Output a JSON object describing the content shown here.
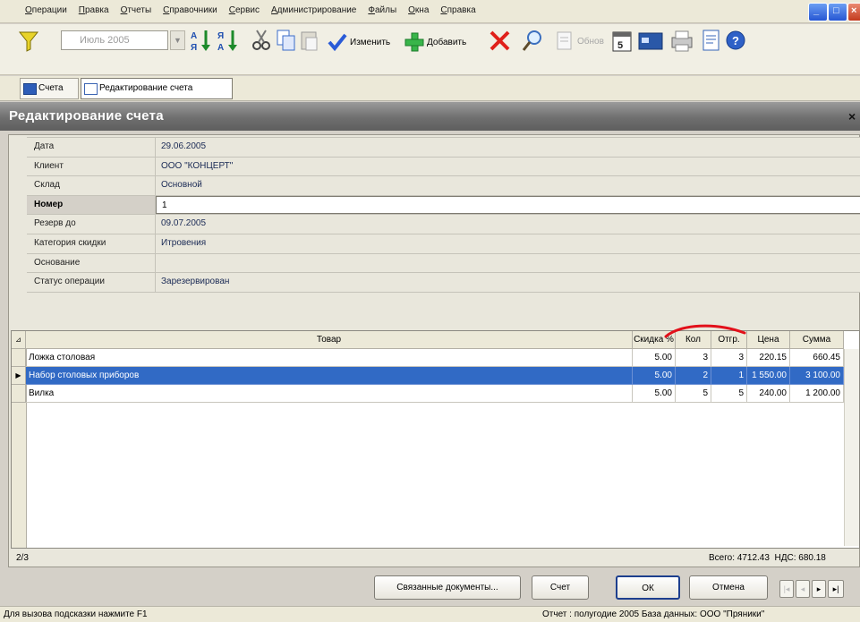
{
  "menu": {
    "items": [
      "Операции",
      "Правка",
      "Отчеты",
      "Справочники",
      "Сервис",
      "Администрирование",
      "Файлы",
      "Окна",
      "Справка"
    ]
  },
  "toolbar": {
    "period_value": "Июль 2005",
    "edit_label": "Изменить",
    "add_label": "Добавить",
    "refresh_label": "Обнов"
  },
  "tabs": [
    {
      "label": "Счета"
    },
    {
      "label": "Редактирование счета"
    }
  ],
  "header": {
    "title": "Редактирование счета"
  },
  "fields": [
    {
      "label": "Дата",
      "value": "29.06.2005"
    },
    {
      "label": "Клиент",
      "value": "ООО \"КОНЦЕРТ\""
    },
    {
      "label": "Склад",
      "value": "Основной"
    },
    {
      "label": "Номер",
      "value": "1"
    },
    {
      "label": "Резерв до",
      "value": "09.07.2005"
    },
    {
      "label": "Категория скидки",
      "value": "Итровения"
    },
    {
      "label": "Основание",
      "value": ""
    },
    {
      "label": "Статус операции",
      "value": "Зарезервирован"
    }
  ],
  "grid": {
    "columns": [
      "Товар",
      "Скидка %",
      "Кол",
      "Отгр.",
      "Цена",
      "Сумма"
    ],
    "rows": [
      [
        "Ложка столовая",
        "5.00",
        "3",
        "3",
        "220.15",
        "660.45"
      ],
      [
        "Набор столовых приборов",
        "5.00",
        "2",
        "1",
        "1 550.00",
        "3 100.00"
      ],
      [
        "Вилка",
        "5.00",
        "5",
        "5",
        "240.00",
        "1 200.00"
      ]
    ],
    "selected_row": 1
  },
  "footer": {
    "counter": "2/3",
    "total": "Всего: 4712.43",
    "vat": "НДС: 680.18"
  },
  "buttons": {
    "linked_docs": "Связанные документы...",
    "invoice": "Счет",
    "ok": "ОК",
    "cancel": "Отмена"
  },
  "status": {
    "hint": "Для вызова подсказки нажмите F1",
    "right": "Отчет : полугодие 2005   База данных: ООО \"Пряники\""
  }
}
